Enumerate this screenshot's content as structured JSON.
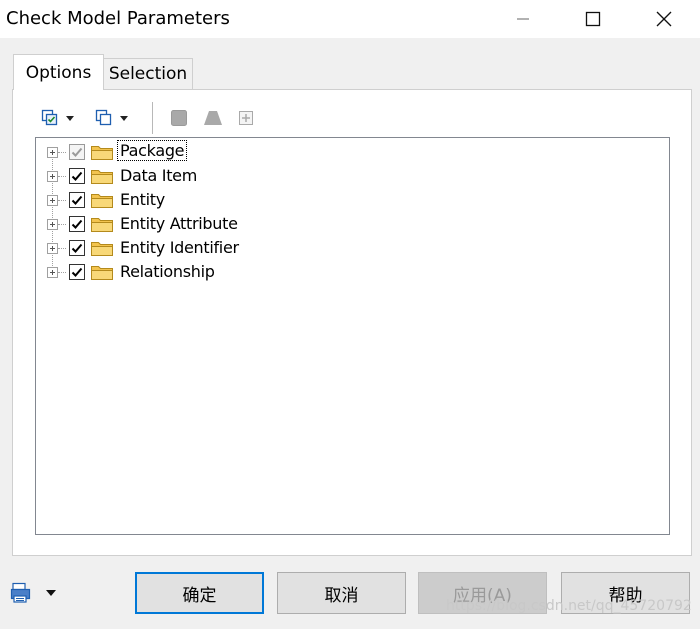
{
  "window": {
    "title": "Check Model Parameters"
  },
  "tabs": [
    {
      "label": "Options",
      "active": true
    },
    {
      "label": "Selection",
      "active": false
    }
  ],
  "toolbar": {
    "tools": [
      {
        "name": "select-all-icon",
        "enabled": true,
        "has_dropdown": true
      },
      {
        "name": "deselect-all-icon",
        "enabled": true,
        "has_dropdown": true
      },
      {
        "name": "square-icon",
        "enabled": false
      },
      {
        "name": "triangle-icon",
        "enabled": false
      },
      {
        "name": "plus-box-icon",
        "enabled": false
      }
    ]
  },
  "tree": {
    "items": [
      {
        "label": "Package",
        "checked": true,
        "grayed": true,
        "focused": true
      },
      {
        "label": "Data Item",
        "checked": true,
        "grayed": false
      },
      {
        "label": "Entity",
        "checked": true,
        "grayed": false
      },
      {
        "label": "Entity Attribute",
        "checked": true,
        "grayed": false
      },
      {
        "label": "Entity Identifier",
        "checked": true,
        "grayed": false
      },
      {
        "label": "Relationship",
        "checked": true,
        "grayed": false
      }
    ]
  },
  "buttons": {
    "ok": "确定",
    "cancel": "取消",
    "apply": "应用(A)",
    "help": "帮助"
  },
  "watermark": "https://blog.csdn.net/qq_45720792",
  "colors": {
    "folder": "#f3c44f",
    "focus_border": "#0078d7"
  }
}
